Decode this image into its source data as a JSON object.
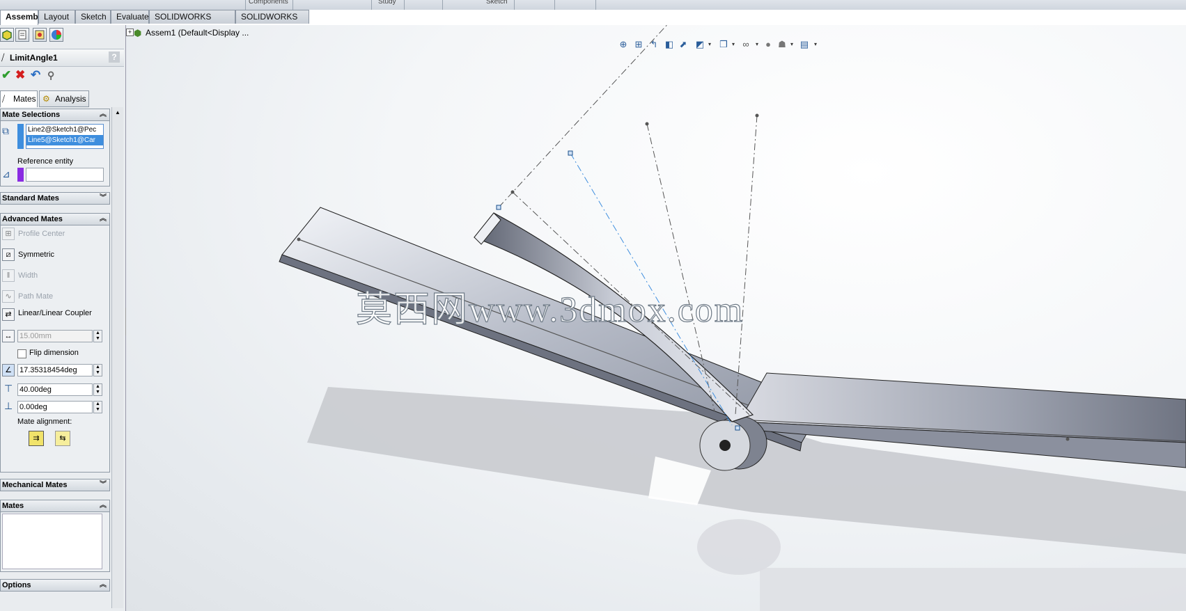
{
  "ribbon": {
    "group_labels": [
      "Components",
      "Study",
      "Sketch"
    ]
  },
  "tabs": [
    {
      "label": "Assembly",
      "active": true
    },
    {
      "label": "Layout"
    },
    {
      "label": "Sketch"
    },
    {
      "label": "Evaluate"
    },
    {
      "label": "SOLIDWORKS Add-Ins"
    },
    {
      "label": "SOLIDWORKS MBD"
    }
  ],
  "property_manager": {
    "title": "LimitAngle1",
    "help_label": "?",
    "panel_tabs": {
      "mates": "Mates",
      "analysis": "Analysis"
    },
    "mate_selections": {
      "header": "Mate Selections",
      "entities": [
        "Line2@Sketch1@Pec",
        "Line5@Sketch1@Car"
      ],
      "reference_label": "Reference entity",
      "reference_value": ""
    },
    "standard_mates": {
      "header": "Standard Mates"
    },
    "advanced_mates": {
      "header": "Advanced Mates",
      "items": {
        "profile_center": "Profile Center",
        "symmetric": "Symmetric",
        "width": "Width",
        "path_mate": "Path Mate",
        "linear_coupler": "Linear/Linear Coupler"
      },
      "distance_value": "15.00mm",
      "flip_label": "Flip dimension",
      "flip_checked": false,
      "angle_value": "17.35318454deg",
      "max_value": "40.00deg",
      "min_value": "0.00deg",
      "alignment_label": "Mate alignment:"
    },
    "mechanical_mates": {
      "header": "Mechanical Mates"
    },
    "mates_list": {
      "header": "Mates"
    },
    "options": {
      "header": "Options"
    }
  },
  "feature_tree": {
    "root_label": "Assem1  (Default<Display ..."
  },
  "watermark": "莫西网www.3dmox.com",
  "colors": {
    "selection_highlight": "#3e8ede",
    "reference_swatch": "#8a2be2",
    "background": "#eef1f4"
  }
}
